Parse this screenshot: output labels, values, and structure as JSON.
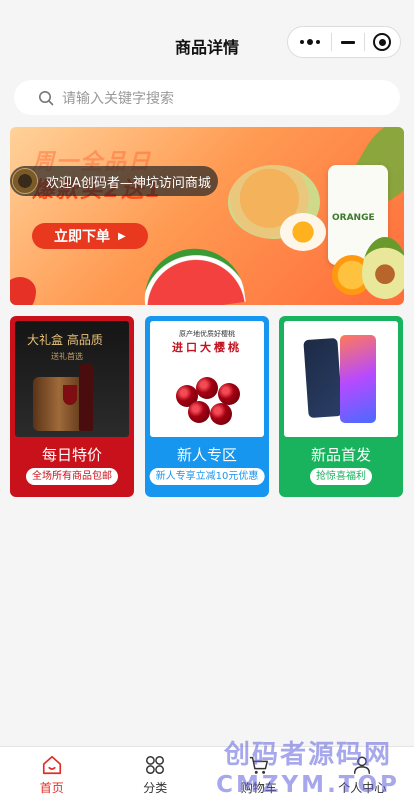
{
  "navbar": {
    "title": "商品详情"
  },
  "search": {
    "placeholder": "请输入关键字搜索"
  },
  "banner": {
    "headline_line1": "周一全品日",
    "headline_line2": "爆款买2送1",
    "cta_label": "立即下单",
    "bottle_label": "ORANGE",
    "notice_text": "欢迎A创码者—神坑访问商城",
    "indicator_count": 3,
    "active_indicator": 1
  },
  "cards": [
    {
      "title": "每日特价",
      "pill": "全场所有商品包邮",
      "image_caption": "大礼盒 高品质",
      "image_sub": "送礼首选",
      "color": "#c8111a"
    },
    {
      "title": "新人专区",
      "pill": "新人专享立减10元优惠",
      "image_caption": "进口大樱桃",
      "image_top": "原产地优质好樱桃",
      "color": "#1796f0"
    },
    {
      "title": "新品首发",
      "pill": "抢惊喜福利",
      "color": "#18b35c"
    }
  ],
  "tabbar": {
    "items": [
      {
        "label": "首页",
        "icon": "home-icon",
        "active": true
      },
      {
        "label": "分类",
        "icon": "grid-icon",
        "active": false
      },
      {
        "label": "购物车",
        "icon": "cart-icon",
        "active": false
      },
      {
        "label": "个人中心",
        "icon": "user-icon",
        "active": false
      }
    ],
    "active_color": "#e02e24"
  },
  "watermark": {
    "line1": "创码者源码网",
    "line2": "CMZYM.TOP"
  }
}
